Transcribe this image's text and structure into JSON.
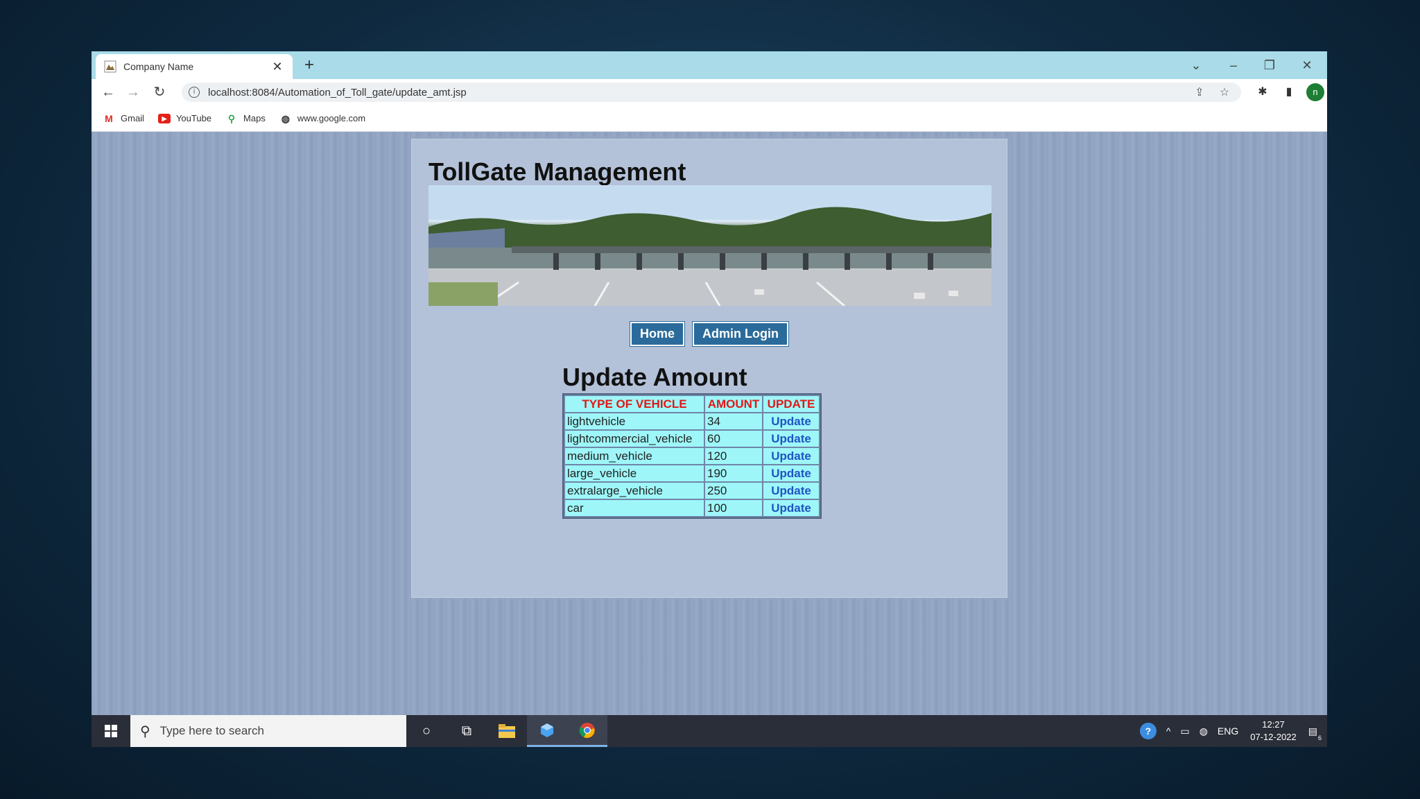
{
  "browser": {
    "tab_title": "Company Name",
    "url": "localhost:8084/Automation_of_Toll_gate/update_amt.jsp",
    "profile_initial": "n",
    "bookmarks": [
      {
        "label": "Gmail",
        "icon": "gmail-icon"
      },
      {
        "label": "YouTube",
        "icon": "youtube-icon"
      },
      {
        "label": "Maps",
        "icon": "maps-icon"
      },
      {
        "label": "www.google.com",
        "icon": "globe-icon"
      }
    ]
  },
  "page": {
    "site_title": "TollGate Management",
    "nav": [
      "Home",
      "Admin Login"
    ],
    "section_title": "Update Amount",
    "table": {
      "headers": [
        "TYPE OF VEHICLE",
        "AMOUNT",
        "UPDATE"
      ],
      "rows": [
        {
          "type": "lightvehicle",
          "amount": "34",
          "action": "Update"
        },
        {
          "type": "lightcommercial_vehicle",
          "amount": "60",
          "action": "Update"
        },
        {
          "type": "medium_vehicle",
          "amount": "120",
          "action": "Update"
        },
        {
          "type": "large_vehicle",
          "amount": "190",
          "action": "Update"
        },
        {
          "type": "extralarge_vehicle",
          "amount": "250",
          "action": "Update"
        },
        {
          "type": "car",
          "amount": "100",
          "action": "Update"
        }
      ]
    }
  },
  "taskbar": {
    "search_placeholder": "Type here to search",
    "lang": "ENG",
    "time": "12:27",
    "date": "07-12-2022",
    "notification_count": "6"
  },
  "colors": {
    "header_text": "#e01818",
    "cell_bg": "#9ef6f8",
    "link": "#1f55c4",
    "nav_button": "#2b6b9b"
  }
}
